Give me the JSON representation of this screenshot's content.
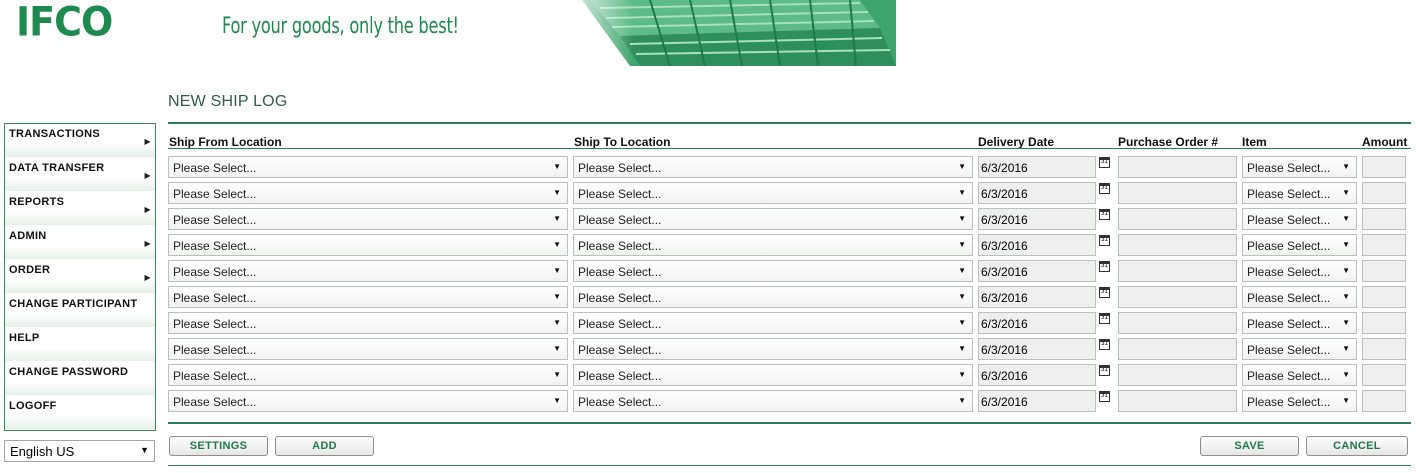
{
  "header": {
    "logo": "IFCO",
    "tagline": "For your goods, only the best!"
  },
  "page_title": "NEW SHIP LOG",
  "sidebar": {
    "items": [
      {
        "label": "TRANSACTIONS",
        "submenu": true
      },
      {
        "label": "DATA TRANSFER",
        "submenu": true
      },
      {
        "label": "REPORTS",
        "submenu": true
      },
      {
        "label": "ADMIN",
        "submenu": true
      },
      {
        "label": "ORDER",
        "submenu": true
      },
      {
        "label": "CHANGE PARTICIPANT",
        "submenu": false
      },
      {
        "label": "HELP",
        "submenu": false
      },
      {
        "label": "CHANGE PASSWORD",
        "submenu": false
      },
      {
        "label": "LOGOFF",
        "submenu": false
      }
    ],
    "language": "English US"
  },
  "columns": {
    "ship_from": "Ship From Location",
    "ship_to": "Ship To Location",
    "delivery_date": "Delivery Date",
    "po": "Purchase Order #",
    "item": "Item",
    "amount": "Amount"
  },
  "rows": [
    {
      "ship_from": "Please Select...",
      "ship_to": "Please Select...",
      "delivery_date": "6/3/2016",
      "po": "",
      "item": "Please Select...",
      "amount": ""
    },
    {
      "ship_from": "Please Select...",
      "ship_to": "Please Select...",
      "delivery_date": "6/3/2016",
      "po": "",
      "item": "Please Select...",
      "amount": ""
    },
    {
      "ship_from": "Please Select...",
      "ship_to": "Please Select...",
      "delivery_date": "6/3/2016",
      "po": "",
      "item": "Please Select...",
      "amount": ""
    },
    {
      "ship_from": "Please Select...",
      "ship_to": "Please Select...",
      "delivery_date": "6/3/2016",
      "po": "",
      "item": "Please Select...",
      "amount": ""
    },
    {
      "ship_from": "Please Select...",
      "ship_to": "Please Select...",
      "delivery_date": "6/3/2016",
      "po": "",
      "item": "Please Select...",
      "amount": ""
    },
    {
      "ship_from": "Please Select...",
      "ship_to": "Please Select...",
      "delivery_date": "6/3/2016",
      "po": "",
      "item": "Please Select...",
      "amount": ""
    },
    {
      "ship_from": "Please Select...",
      "ship_to": "Please Select...",
      "delivery_date": "6/3/2016",
      "po": "",
      "item": "Please Select...",
      "amount": ""
    },
    {
      "ship_from": "Please Select...",
      "ship_to": "Please Select...",
      "delivery_date": "6/3/2016",
      "po": "",
      "item": "Please Select...",
      "amount": ""
    },
    {
      "ship_from": "Please Select...",
      "ship_to": "Please Select...",
      "delivery_date": "6/3/2016",
      "po": "",
      "item": "Please Select...",
      "amount": ""
    },
    {
      "ship_from": "Please Select...",
      "ship_to": "Please Select...",
      "delivery_date": "6/3/2016",
      "po": "",
      "item": "Please Select...",
      "amount": ""
    }
  ],
  "buttons": {
    "settings": "SETTINGS",
    "add": "ADD",
    "save": "SAVE",
    "cancel": "CANCEL"
  },
  "colors": {
    "brand_green": "#1e8a4f",
    "rule_green": "#2e7d57"
  }
}
